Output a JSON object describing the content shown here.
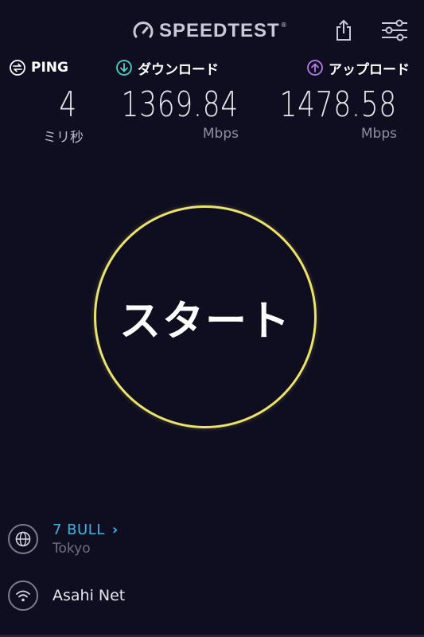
{
  "header": {
    "logo_text": "SPEEDTEST",
    "logo_tm": "®",
    "share_icon": "share-icon",
    "settings_icon": "settings-sliders-icon"
  },
  "metrics": {
    "ping": {
      "label": "PING",
      "value": "4",
      "unit": "ミリ秒",
      "icon": "ping-icon"
    },
    "download": {
      "label": "ダウンロード",
      "value": "1369.84",
      "unit": "Mbps",
      "icon": "download-arrow-icon",
      "icon_color": "#4fd1c5"
    },
    "upload": {
      "label": "アップロード",
      "value": "1478.58",
      "unit": "Mbps",
      "icon": "upload-arrow-icon",
      "icon_color": "#b57be6"
    }
  },
  "start_button": {
    "label": "スタート",
    "ring_color": "#ece36a"
  },
  "server": {
    "name": "7 BULL",
    "chevron": "›",
    "city": "Tokyo",
    "icon": "globe-icon",
    "accent": "#3fb4e4"
  },
  "isp": {
    "name": "Asahi Net",
    "icon": "wifi-icon"
  }
}
